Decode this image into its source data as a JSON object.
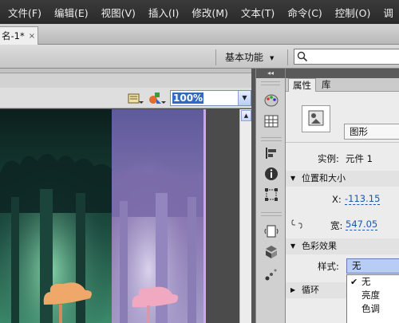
{
  "menu": [
    "文件(F)",
    "编辑(E)",
    "视图(V)",
    "插入(I)",
    "修改(M)",
    "文本(T)",
    "命令(C)",
    "控制(O)",
    "调"
  ],
  "document_tab": {
    "title": "名-1*",
    "close": "×"
  },
  "workspace": {
    "label": "基本功能",
    "caret": "▼"
  },
  "search": {
    "value": ""
  },
  "zoom": {
    "value": "100%",
    "arrow": "▼"
  },
  "dock": {
    "collapse_glyph": "◂◂"
  },
  "properties": {
    "tabs": [
      "属性",
      "库"
    ],
    "symbol_type": "图形",
    "instance_label": "实例:",
    "instance_value": "元件 1",
    "position_section": "位置和大小",
    "x_label": "X:",
    "x_value": "-113.15",
    "w_label": "宽:",
    "w_value": "547.05",
    "color_section": "色彩效果",
    "style_label": "样式:",
    "style_value": "无",
    "loop_section": "循环"
  },
  "style_dropdown": {
    "options": [
      "无",
      "亮度",
      "色调"
    ],
    "selected_mark": "✔"
  },
  "colors": {
    "menubar": "#2f2f2f",
    "selection": "#316ac5",
    "link": "#1a57a8"
  }
}
